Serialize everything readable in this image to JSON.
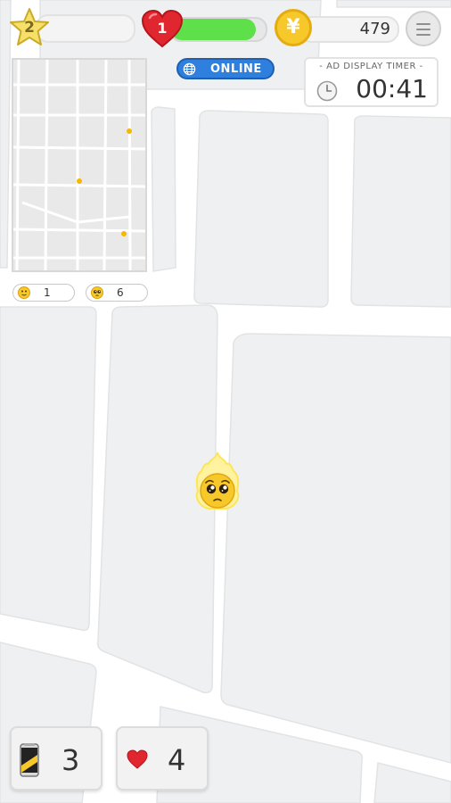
{
  "hud": {
    "level": "2",
    "hearts": "1",
    "health_fraction": 0.9,
    "coins": "479",
    "coin_symbol": "¥",
    "icons": [
      "star-icon",
      "heart-icon",
      "coin-icon",
      "menu-icon"
    ]
  },
  "status": {
    "label": "ONLINE",
    "icon": "globe-icon",
    "color": "#2e7fde"
  },
  "ad_timer": {
    "title": "- AD DISPLAY TIMER -",
    "value": "00:41",
    "icon": "clock-icon"
  },
  "minimap": {
    "counters": [
      {
        "icon": "smiley-face-icon",
        "count": "1"
      },
      {
        "icon": "pleading-face-icon",
        "count": "6"
      }
    ]
  },
  "inventory": [
    {
      "icon": "energy-drink-icon",
      "count": "3"
    },
    {
      "icon": "heart-icon",
      "count": "4"
    }
  ],
  "player": {
    "icon": "pleading-face-icon"
  },
  "colors": {
    "map_block": "#eef0f2",
    "map_road": "#ffffff",
    "coin": "#f7c82a",
    "health": "#5de04a",
    "heart": "#e0262e"
  }
}
